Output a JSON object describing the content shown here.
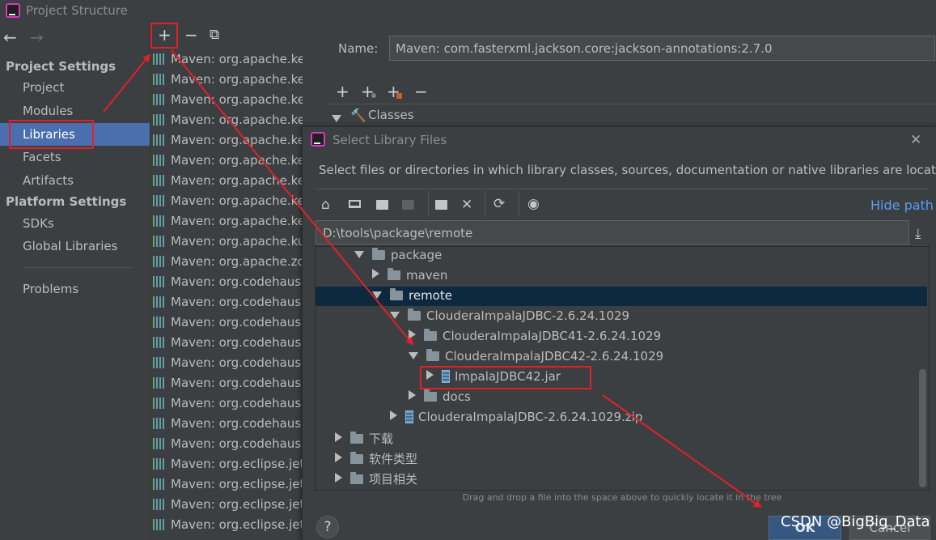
{
  "window": {
    "title": "Project Structure"
  },
  "left_panel": {
    "back_icon": "←",
    "forward_icon": "→",
    "project_settings_header": "Project Settings",
    "project_items": [
      "Project",
      "Modules",
      "Libraries",
      "Facets",
      "Artifacts"
    ],
    "platform_settings_header": "Platform Settings",
    "platform_items": [
      "SDKs",
      "Global Libraries"
    ],
    "problems": "Problems",
    "selected_item": "Libraries"
  },
  "library_toolbar": {
    "add": "+",
    "remove": "−",
    "copy": "⧉"
  },
  "libraries": [
    "Maven: org.apache.kerby:l",
    "Maven: org.apache.kerby:l",
    "Maven: org.apache.kerby:l",
    "Maven: org.apache.kerby:",
    "Maven: org.apache.ke",
    "Maven: org.apache.ke",
    "Maven: org.apache.ke",
    "Maven: org.apache.ke",
    "Maven: org.apache.ke",
    "Maven: org.apache.ku",
    "Maven: org.apache.zo",
    "Maven: org.codehaus.",
    "Maven: org.codehaus.",
    "Maven: org.codehaus.",
    "Maven: org.codehaus.",
    "Maven: org.codehaus.",
    "Maven: org.codehaus.",
    "Maven: org.codehaus.",
    "Maven: org.codehaus.",
    "Maven: org.codehaus.",
    "Maven: org.eclipse.jet",
    "Maven: org.eclipse.jet",
    "Maven: org.eclipse.jet",
    "Maven: org.eclipse.jet"
  ],
  "detail": {
    "name_label": "Name:",
    "name_value": "Maven: com.fasterxml.jackson.core:jackson-annotations:2.7.0",
    "toolbar": [
      "+",
      "+",
      "+",
      "−"
    ],
    "classes_label": "Classes"
  },
  "dialog": {
    "title": "Select Library Files",
    "close_icon": "✕",
    "description": "Select files or directories in which library classes, sources, documentation or native libraries are located",
    "hide_path": "Hide path",
    "path": "D:\\tools\\package\\remote",
    "tree": [
      {
        "label": "package",
        "expanded": true,
        "type": "folder"
      },
      {
        "label": "maven",
        "expanded": false,
        "type": "folder"
      },
      {
        "label": "remote",
        "expanded": true,
        "type": "folder",
        "selected": true
      },
      {
        "label": "ClouderaImpalaJDBC-2.6.24.1029",
        "expanded": true,
        "type": "folder"
      },
      {
        "label": "ClouderaImpalaJDBC41-2.6.24.1029",
        "expanded": false,
        "type": "folder"
      },
      {
        "label": "ClouderaImpalaJDBC42-2.6.24.1029",
        "expanded": true,
        "type": "folder"
      },
      {
        "label": "ImpalaJDBC42.jar",
        "expanded": false,
        "type": "jar",
        "highlighted": true
      },
      {
        "label": "docs",
        "expanded": false,
        "type": "folder"
      },
      {
        "label": "ClouderaImpalaJDBC-2.6.24.1029.zip",
        "expanded": false,
        "type": "zip"
      },
      {
        "label": "下载",
        "expanded": false,
        "type": "folder"
      },
      {
        "label": "软件类型",
        "expanded": false,
        "type": "folder"
      },
      {
        "label": "项目相关",
        "expanded": false,
        "type": "folder"
      }
    ],
    "hint": "Drag and drop a file into the space above to quickly locate it in the tree",
    "help": "?",
    "ok": "OK",
    "cancel": "Cancel"
  },
  "watermark": "CSDN @BigBig_Data",
  "colors": {
    "selection": "#4b6eaf",
    "tree_selection": "#0d293e",
    "annotation": "#e0202a",
    "link": "#589df6"
  }
}
